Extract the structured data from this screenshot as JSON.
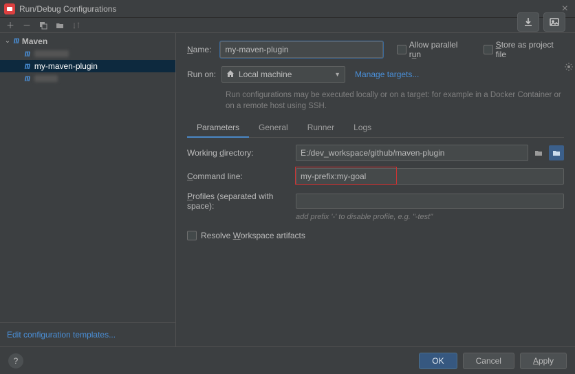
{
  "title": "Run/Debug Configurations",
  "sidebar": {
    "root_label": "Maven",
    "items": [
      {
        "label": ""
      },
      {
        "label": "my-maven-plugin"
      },
      {
        "label": ""
      }
    ],
    "edit_templates": "Edit configuration templates..."
  },
  "form": {
    "name_label": "Name:",
    "name_value": "my-maven-plugin",
    "allow_parallel": "Allow parallel run",
    "store_as_project": "Store as project file",
    "runon_label": "Run on:",
    "runon_value": "Local machine",
    "manage_targets": "Manage targets...",
    "runon_hint": "Run configurations may be executed locally or on a target: for example in a Docker Container or on a remote host using SSH."
  },
  "tabs": [
    "Parameters",
    "General",
    "Runner",
    "Logs"
  ],
  "params": {
    "wd_label": "Working directory:",
    "wd_value": "E:/dev_workspace/github/maven-plugin",
    "cmd_label": "Command line:",
    "cmd_value": "my-prefix:my-goal",
    "profiles_label": "Profiles (separated with space):",
    "profiles_value": "",
    "profiles_hint": "add prefix '-' to disable profile, e.g. \"-test\"",
    "resolve_label": "Resolve Workspace artifacts"
  },
  "buttons": {
    "ok": "OK",
    "cancel": "Cancel",
    "apply": "Apply"
  }
}
